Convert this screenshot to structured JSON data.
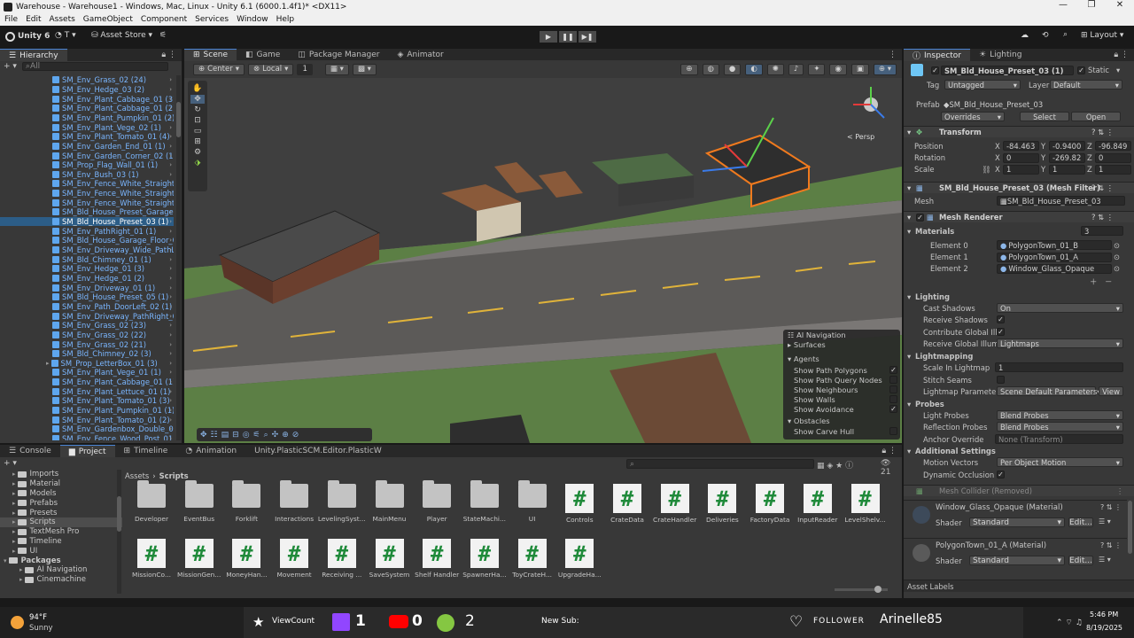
{
  "window": {
    "title": "Warehouse - Warehouse1 - Windows, Mac, Linux - Unity 6.1 (6000.1.4f1)* <DX11>"
  },
  "menu": [
    "File",
    "Edit",
    "Assets",
    "GameObject",
    "Component",
    "Services",
    "Window",
    "Help"
  ],
  "toolbar": {
    "unity_label": "Unity 6",
    "account_label": "T",
    "asset_store_label": "Asset Store",
    "layout_label": "Layout"
  },
  "hierarchy": {
    "tab": "Hierarchy",
    "search_placeholder": "All",
    "items": [
      "SM_Env_Grass_02 (24)",
      "SM_Env_Hedge_03 (2)",
      "SM_Env_Plant_Cabbage_01 (3)",
      "SM_Env_Plant_Cabbage_01 (2)",
      "SM_Env_Plant_Pumpkin_01 (2)",
      "SM_Env_Plant_Vege_02 (1)",
      "SM_Env_Plant_Tomato_01 (4)",
      "SM_Env_Garden_End_01 (1)",
      "SM_Env_Garden_Corner_02 (1)",
      "SM_Prop_Flag_Wall_01 (1)",
      "SM_Env_Bush_03 (1)",
      "SM_Env_Fence_White_Straight",
      "SM_Env_Fence_White_Straight",
      "SM_Env_Fence_White_Straight",
      "SM_Bld_House_Preset_Garage",
      "SM_Bld_House_Preset_03 (1)",
      "SM_Env_PathRight_01 (1)",
      "SM_Bld_House_Garage_Floor_0",
      "SM_Env_Driveway_Wide_PathL",
      "SM_Bld_Chimney_01 (1)",
      "SM_Env_Hedge_01 (3)",
      "SM_Env_Hedge_01 (2)",
      "SM_Env_Driveway_01 (1)",
      "SM_Bld_House_Preset_05 (1)",
      "SM_Env_Path_DoorLeft_02 (1)",
      "SM_Env_Driveway_PathRight_0",
      "SM_Env_Grass_02 (23)",
      "SM_Env_Grass_02 (22)",
      "SM_Env_Grass_02 (21)",
      "SM_Bld_Chimney_02 (3)",
      "SM_Prop_LetterBox_01 (3)",
      "SM_Env_Plant_Vege_01 (1)",
      "SM_Env_Plant_Cabbage_01 (1)",
      "SM_Env_Plant_Lettuce_01 (1)",
      "SM_Env_Plant_Tomato_01 (3)",
      "SM_Env_Plant_Pumpkin_01 (1)",
      "SM_Env_Plant_Tomato_01 (2)",
      "SM_Env_Gardenbox_Double_01",
      "SM_Env_Fence_Wood_Post_01"
    ],
    "selected_index": 15
  },
  "scene": {
    "tabs": [
      "Scene",
      "Game",
      "Package Manager",
      "Animator"
    ],
    "pivot": "Center",
    "space": "Local",
    "grid_value": "1",
    "persp_label": "< Persp",
    "nav_overlay": {
      "title": "AI Navigation",
      "surfaces": "Surfaces",
      "agents": "Agents",
      "items": [
        {
          "label": "Show Path Polygons",
          "checked": true
        },
        {
          "label": "Show Path Query Nodes",
          "checked": false
        },
        {
          "label": "Show Neighbours",
          "checked": false
        },
        {
          "label": "Show Walls",
          "checked": false
        },
        {
          "label": "Show Avoidance",
          "checked": true
        }
      ],
      "obstacles": "Obstacles",
      "carve": "Show Carve Hull"
    }
  },
  "inspector": {
    "tabs": [
      "Inspector",
      "Lighting"
    ],
    "object_name": "SM_Bld_House_Preset_03 (1)",
    "static_label": "Static",
    "tag_label": "Tag",
    "tag": "Untagged",
    "layer_label": "Layer",
    "layer": "Default",
    "prefab_label": "Prefab",
    "prefab": "SM_Bld_House_Preset_03",
    "overrides": "Overrides",
    "select": "Select",
    "open": "Open",
    "transform": {
      "title": "Transform",
      "position": {
        "label": "Position",
        "x": "-84.463",
        "y": "-0.9400",
        "z": "-96.849"
      },
      "rotation": {
        "label": "Rotation",
        "x": "0",
        "y": "-269.82",
        "z": "0"
      },
      "scale": {
        "label": "Scale",
        "x": "1",
        "y": "1",
        "z": "1"
      }
    },
    "mesh_filter": {
      "title": "SM_Bld_House_Preset_03 (Mesh Filter)",
      "mesh_label": "Mesh",
      "mesh": "SM_Bld_House_Preset_03"
    },
    "mesh_renderer": {
      "title": "Mesh Renderer",
      "materials_label": "Materials",
      "count": "3",
      "elements": [
        {
          "label": "Element 0",
          "value": "PolygonTown_01_B"
        },
        {
          "label": "Element 1",
          "value": "PolygonTown_01_A"
        },
        {
          "label": "Element 2",
          "value": "Window_Glass_Opaque"
        }
      ]
    },
    "lighting": {
      "title": "Lighting",
      "cast_label": "Cast Shadows",
      "cast": "On",
      "receive_label": "Receive Shadows",
      "contrib_label": "Contribute Global Illu",
      "rgi_label": "Receive Global Illumi",
      "rgi": "Lightmaps"
    },
    "lightmapping": {
      "title": "Lightmapping",
      "scale_label": "Scale In Lightmap",
      "scale": "1",
      "stitch_label": "Stitch Seams",
      "params_label": "Lightmap Parameters",
      "params": "Scene Default Parameters",
      "view": "View"
    },
    "probes": {
      "title": "Probes",
      "light_label": "Light Probes",
      "light": "Blend Probes",
      "refl_label": "Reflection Probes",
      "refl": "Blend Probes",
      "anchor_label": "Anchor Override",
      "anchor": "None (Transform)"
    },
    "additional": {
      "title": "Additional Settings",
      "mv_label": "Motion Vectors",
      "mv": "Per Object Motion",
      "occ_label": "Dynamic Occlusion"
    },
    "collider_removed": "Mesh Collider (Removed)",
    "materials": [
      {
        "name": "Window_Glass_Opaque (Material)",
        "shader_label": "Shader",
        "shader": "Standard",
        "edit": "Edit..."
      },
      {
        "name": "PolygonTown_01_A (Material)",
        "shader_label": "Shader",
        "shader": "Standard",
        "edit": "Edit..."
      }
    ],
    "asset_labels": "Asset Labels"
  },
  "project": {
    "tabs": [
      "Console",
      "Project",
      "Timeline",
      "Animation",
      "Unity.PlasticSCM.Editor.PlasticW"
    ],
    "tree": [
      "Imports",
      "Material",
      "Models",
      "Prefabs",
      "Presets",
      "Scripts",
      "TextMesh Pro",
      "Timeline",
      "UI",
      "Packages",
      "AI Navigation",
      "Cinemachine"
    ],
    "tree_selected": 5,
    "breadcrumb": [
      "Assets",
      "Scripts"
    ],
    "hidden_count": "21",
    "folders": [
      "Developer",
      "EventBus",
      "Forklift",
      "Interactions",
      "LevelingSyst...",
      "MainMenu",
      "Player",
      "StateMachi...",
      "UI"
    ],
    "scripts": [
      "Controls",
      "CrateData",
      "CrateHandler",
      "Deliveries",
      "FactoryData",
      "InputReader",
      "LevelShelv...",
      "MissionCo...",
      "MissionGen...",
      "MoneyHan...",
      "Movement",
      "Receiving ...",
      "SaveSystem",
      "Shelf Handler",
      "SpawnerHa...",
      "ToyCrateH...",
      "UpgradeHa..."
    ]
  },
  "taskbar": {
    "weather_temp": "94°F",
    "weather_desc": "Sunny",
    "viewcount_label": "ViewCount",
    "twitch_count": "1",
    "youtube_count": "0",
    "rumble_count": "2",
    "new_sub_label": "New Sub:",
    "follower_label": "FOLLOWER",
    "follower_name": "Arinelle85",
    "time": "5:46 PM",
    "date": "8/19/2025"
  }
}
